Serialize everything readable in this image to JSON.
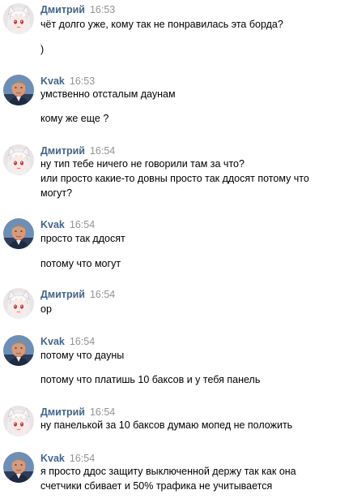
{
  "messages": [
    {
      "author": "Дмитрий",
      "time": "16:53",
      "avatar_icon": "anime-girl-avatar-icon",
      "lines": [
        "чёт долго уже, кому так не понравилась эта борда?",
        ")"
      ]
    },
    {
      "author": "Kvak",
      "time": "16:53",
      "avatar_icon": "man-avatar-icon",
      "lines": [
        "умственно отсталым даунам",
        "кому же еще ?"
      ]
    },
    {
      "author": "Дмитрий",
      "time": "16:54",
      "avatar_icon": "anime-girl-avatar-icon",
      "lines": [
        "ну тип тебе ничего не говорили там за что?",
        "или просто какие-то довны просто так ддосят потому что",
        "могут?"
      ]
    },
    {
      "author": "Kvak",
      "time": "16:54",
      "avatar_icon": "man-avatar-icon",
      "lines": [
        "просто так ддосят",
        "потому что могут"
      ]
    },
    {
      "author": "Дмитрий",
      "time": "16:54",
      "avatar_icon": "anime-girl-avatar-icon",
      "lines": [
        "ор"
      ]
    },
    {
      "author": "Kvak",
      "time": "16:54",
      "avatar_icon": "man-avatar-icon",
      "lines": [
        "потому что дауны",
        "потому что платишь 10 баксов и у тебя панель"
      ]
    },
    {
      "author": "Дмитрий",
      "time": "16:54",
      "avatar_icon": "anime-girl-avatar-icon",
      "lines": [
        "ну панелькой за 10 баксов думаю мопед не положить"
      ]
    },
    {
      "author": "Kvak",
      "time": "16:54",
      "avatar_icon": "man-avatar-icon",
      "lines": [
        "я просто ддос защиту выключенной держу так как она",
        "счетчики сбивает и 50% трафика не учитывается"
      ]
    }
  ]
}
